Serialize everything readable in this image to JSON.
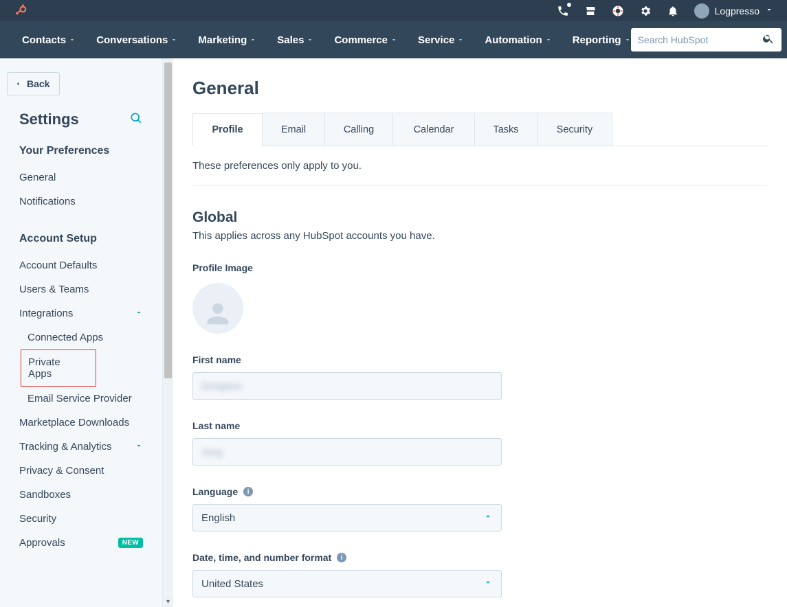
{
  "topbar": {
    "account_name": "Logpresso"
  },
  "nav": {
    "items": [
      "Contacts",
      "Conversations",
      "Marketing",
      "Sales",
      "Commerce",
      "Service",
      "Automation",
      "Reporting"
    ],
    "search_placeholder": "Search HubSpot"
  },
  "sidebar": {
    "back_label": "Back",
    "settings_title": "Settings",
    "prefs_heading": "Your Preferences",
    "prefs_items": [
      "General",
      "Notifications"
    ],
    "setup_heading": "Account Setup",
    "setup_items": {
      "account_defaults": "Account Defaults",
      "users_teams": "Users & Teams",
      "integrations": "Integrations",
      "integrations_children": [
        "Connected Apps",
        "Private Apps",
        "Email Service Provider"
      ],
      "marketplace_downloads": "Marketplace Downloads",
      "tracking_analytics": "Tracking & Analytics",
      "privacy_consent": "Privacy & Consent",
      "sandboxes": "Sandboxes",
      "security": "Security",
      "approvals": "Approvals",
      "approvals_badge": "NEW"
    }
  },
  "main": {
    "page_title": "General",
    "tabs": [
      "Profile",
      "Email",
      "Calling",
      "Calendar",
      "Tasks",
      "Security"
    ],
    "active_tab_index": 0,
    "hint": "These preferences only apply to you.",
    "global_title": "Global",
    "global_sub": "This applies across any HubSpot accounts you have.",
    "labels": {
      "profile_image": "Profile Image",
      "first_name": "First name",
      "last_name": "Last name",
      "language": "Language",
      "date_format": "Date, time, and number format"
    },
    "values": {
      "first_name": "Dongwon",
      "last_name": "Jung",
      "language": "English",
      "date_format": "United States"
    }
  }
}
